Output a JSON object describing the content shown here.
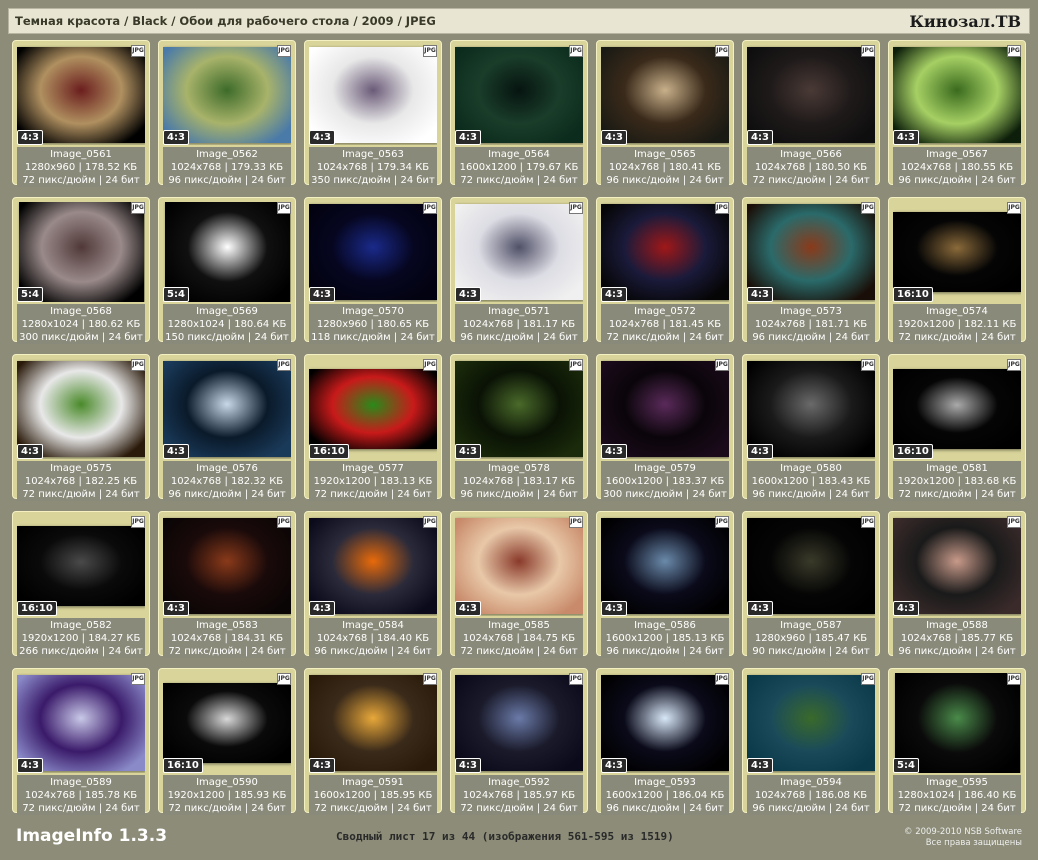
{
  "header": {
    "breadcrumb": "Темная красота / Black / Обои для рабочего стола / 2009 / JPEG",
    "brand": "Кинозал.ТВ"
  },
  "badge_label": "JPG",
  "images": [
    {
      "name": "Image_0561",
      "res": "1280x960",
      "size": "178.52 КБ",
      "dpi": "72 пикс/дюйм",
      "bits": "24 бит",
      "ratio": "4:3",
      "aspect": 1.333,
      "colors": [
        "#000000",
        "#6b1e1e",
        "#b09060"
      ]
    },
    {
      "name": "Image_0562",
      "res": "1024x768",
      "size": "179.33 КБ",
      "dpi": "96 пикс/дюйм",
      "bits": "24 бит",
      "ratio": "4:3",
      "aspect": 1.333,
      "colors": [
        "#4a7aa8",
        "#3d6b2a",
        "#a8b36a"
      ]
    },
    {
      "name": "Image_0563",
      "res": "1024x768",
      "size": "179.34 КБ",
      "dpi": "350 пикс/дюйм",
      "bits": "24 бит",
      "ratio": "4:3",
      "aspect": 1.333,
      "colors": [
        "#ffffff",
        "#6a5a78",
        "#e8e8e8"
      ]
    },
    {
      "name": "Image_0564",
      "res": "1600x1200",
      "size": "179.67 КБ",
      "dpi": "72 пикс/дюйм",
      "bits": "24 бит",
      "ratio": "4:3",
      "aspect": 1.333,
      "colors": [
        "#0b2b1c",
        "#061410",
        "#1a3d2a"
      ]
    },
    {
      "name": "Image_0565",
      "res": "1024x768",
      "size": "180.41 КБ",
      "dpi": "96 пикс/дюйм",
      "bits": "24 бит",
      "ratio": "4:3",
      "aspect": 1.333,
      "colors": [
        "#1a1a14",
        "#c8b08a",
        "#3a2a1a"
      ]
    },
    {
      "name": "Image_0566",
      "res": "1024x768",
      "size": "180.50 КБ",
      "dpi": "72 пикс/дюйм",
      "bits": "24 бит",
      "ratio": "4:3",
      "aspect": 1.333,
      "colors": [
        "#0e0e0e",
        "#4a3a36",
        "#1f1a1a"
      ]
    },
    {
      "name": "Image_0567",
      "res": "1024x768",
      "size": "180.55 КБ",
      "dpi": "96 пикс/дюйм",
      "bits": "24 бит",
      "ratio": "4:3",
      "aspect": 1.333,
      "colors": [
        "#0d1f0a",
        "#3a6a1e",
        "#a6d064"
      ]
    },
    {
      "name": "Image_0568",
      "res": "1280x1024",
      "size": "180.62 КБ",
      "dpi": "300 пикс/дюйм",
      "bits": "24 бит",
      "ratio": "5:4",
      "aspect": 1.25,
      "colors": [
        "#000000",
        "#503838",
        "#9a8a8a"
      ]
    },
    {
      "name": "Image_0569",
      "res": "1280x1024",
      "size": "180.64 КБ",
      "dpi": "150 пикс/дюйм",
      "bits": "24 бит",
      "ratio": "5:4",
      "aspect": 1.25,
      "colors": [
        "#000000",
        "#ffffff",
        "#101010"
      ]
    },
    {
      "name": "Image_0570",
      "res": "1280x960",
      "size": "180.65 КБ",
      "dpi": "118 пикс/дюйм",
      "bits": "24 бит",
      "ratio": "4:3",
      "aspect": 1.333,
      "colors": [
        "#020210",
        "#1a2a8a",
        "#060620"
      ]
    },
    {
      "name": "Image_0571",
      "res": "1024x768",
      "size": "181.17 КБ",
      "dpi": "96 пикс/дюйм",
      "bits": "24 бит",
      "ratio": "4:3",
      "aspect": 1.333,
      "colors": [
        "#f0f0f0",
        "#505068",
        "#dcdce4"
      ]
    },
    {
      "name": "Image_0572",
      "res": "1024x768",
      "size": "181.45 КБ",
      "dpi": "72 пикс/дюйм",
      "bits": "24 бит",
      "ratio": "4:3",
      "aspect": 1.333,
      "colors": [
        "#050505",
        "#a01818",
        "#1a1a3a"
      ]
    },
    {
      "name": "Image_0573",
      "res": "1024x768",
      "size": "181.71 КБ",
      "dpi": "96 пикс/дюйм",
      "bits": "24 бит",
      "ratio": "4:3",
      "aspect": 1.333,
      "colors": [
        "#1a0f08",
        "#8a3a1a",
        "#2a6a6a"
      ]
    },
    {
      "name": "Image_0574",
      "res": "1920x1200",
      "size": "182.11 КБ",
      "dpi": "72 пикс/дюйм",
      "bits": "24 бит",
      "ratio": "16:10",
      "aspect": 1.6,
      "colors": [
        "#000000",
        "#8a6a3a",
        "#050505"
      ]
    },
    {
      "name": "Image_0575",
      "res": "1024x768",
      "size": "182.25 КБ",
      "dpi": "72 пикс/дюйм",
      "bits": "24 бит",
      "ratio": "4:3",
      "aspect": 1.333,
      "colors": [
        "#2a1a0a",
        "#4a8a2a",
        "#e8e8e8"
      ]
    },
    {
      "name": "Image_0576",
      "res": "1024x768",
      "size": "182.32 КБ",
      "dpi": "96 пикс/дюйм",
      "bits": "24 бит",
      "ratio": "4:3",
      "aspect": 1.333,
      "colors": [
        "#1a3a5a",
        "#c8d8e8",
        "#0a1a2a"
      ]
    },
    {
      "name": "Image_0577",
      "res": "1920x1200",
      "size": "183.13 КБ",
      "dpi": "72 пикс/дюйм",
      "bits": "24 бит",
      "ratio": "16:10",
      "aspect": 1.6,
      "colors": [
        "#000000",
        "#2a8a1a",
        "#c81a1a"
      ]
    },
    {
      "name": "Image_0578",
      "res": "1024x768",
      "size": "183.17 КБ",
      "dpi": "96 пикс/дюйм",
      "bits": "24 бит",
      "ratio": "4:3",
      "aspect": 1.333,
      "colors": [
        "#1a2a0a",
        "#4a6a2a",
        "#0a1205"
      ]
    },
    {
      "name": "Image_0579",
      "res": "1600x1200",
      "size": "183.37 КБ",
      "dpi": "300 пикс/дюйм",
      "bits": "24 бит",
      "ratio": "4:3",
      "aspect": 1.333,
      "colors": [
        "#1a0a1a",
        "#5a2a5a",
        "#0a050a"
      ]
    },
    {
      "name": "Image_0580",
      "res": "1600x1200",
      "size": "183.43 КБ",
      "dpi": "96 пикс/дюйм",
      "bits": "24 бит",
      "ratio": "4:3",
      "aspect": 1.333,
      "colors": [
        "#000000",
        "#6a6a6a",
        "#1a1a1a"
      ]
    },
    {
      "name": "Image_0581",
      "res": "1920x1200",
      "size": "183.68 КБ",
      "dpi": "72 пикс/дюйм",
      "bits": "24 бит",
      "ratio": "16:10",
      "aspect": 1.6,
      "colors": [
        "#000000",
        "#aaaaaa",
        "#050505"
      ]
    },
    {
      "name": "Image_0582",
      "res": "1920x1200",
      "size": "184.27 КБ",
      "dpi": "266 пикс/дюйм",
      "bits": "24 бит",
      "ratio": "16:10",
      "aspect": 1.6,
      "colors": [
        "#000000",
        "#4a4a4a",
        "#0a0a0a"
      ]
    },
    {
      "name": "Image_0583",
      "res": "1024x768",
      "size": "184.31 КБ",
      "dpi": "72 пикс/дюйм",
      "bits": "24 бит",
      "ratio": "4:3",
      "aspect": 1.333,
      "colors": [
        "#0a0505",
        "#8a3a1a",
        "#1a0a0a"
      ]
    },
    {
      "name": "Image_0584",
      "res": "1024x768",
      "size": "184.40 КБ",
      "dpi": "96 пикс/дюйм",
      "bits": "24 бит",
      "ratio": "4:3",
      "aspect": 1.333,
      "colors": [
        "#0a0a1a",
        "#e86a0a",
        "#2a2a3a"
      ]
    },
    {
      "name": "Image_0585",
      "res": "1024x768",
      "size": "184.75 КБ",
      "dpi": "72 пикс/дюйм",
      "bits": "24 бит",
      "ratio": "4:3",
      "aspect": 1.333,
      "colors": [
        "#c88a6a",
        "#8a3a2a",
        "#e8c8a8"
      ]
    },
    {
      "name": "Image_0586",
      "res": "1600x1200",
      "size": "185.13 КБ",
      "dpi": "96 пикс/дюйм",
      "bits": "24 бит",
      "ratio": "4:3",
      "aspect": 1.333,
      "colors": [
        "#000000",
        "#6a8aaa",
        "#0a0a1a"
      ]
    },
    {
      "name": "Image_0587",
      "res": "1280x960",
      "size": "185.47 КБ",
      "dpi": "90 пикс/дюйм",
      "bits": "24 бит",
      "ratio": "4:3",
      "aspect": 1.333,
      "colors": [
        "#000000",
        "#3a3a2a",
        "#050505"
      ]
    },
    {
      "name": "Image_0588",
      "res": "1024x768",
      "size": "185.77 КБ",
      "dpi": "96 пикс/дюйм",
      "bits": "24 бит",
      "ratio": "4:3",
      "aspect": 1.333,
      "colors": [
        "#3a2a2a",
        "#c89a8a",
        "#1a1a1a"
      ]
    },
    {
      "name": "Image_0589",
      "res": "1024x768",
      "size": "185.78 КБ",
      "dpi": "72 пикс/дюйм",
      "bits": "24 бит",
      "ratio": "4:3",
      "aspect": 1.333,
      "colors": [
        "#8a8ac8",
        "#c8c8e8",
        "#3a1a6a"
      ]
    },
    {
      "name": "Image_0590",
      "res": "1920x1200",
      "size": "185.93 КБ",
      "dpi": "72 пикс/дюйм",
      "bits": "24 бит",
      "ratio": "16:10",
      "aspect": 1.6,
      "colors": [
        "#000000",
        "#d8d8d8",
        "#0a0a0a"
      ]
    },
    {
      "name": "Image_0591",
      "res": "1600x1200",
      "size": "185.95 КБ",
      "dpi": "72 пикс/дюйм",
      "bits": "24 бит",
      "ratio": "4:3",
      "aspect": 1.333,
      "colors": [
        "#2a1a0a",
        "#e8a83a",
        "#3a2a1a"
      ]
    },
    {
      "name": "Image_0592",
      "res": "1024x768",
      "size": "185.97 КБ",
      "dpi": "72 пикс/дюйм",
      "bits": "24 бит",
      "ratio": "4:3",
      "aspect": 1.333,
      "colors": [
        "#0a0a1a",
        "#6a7aa8",
        "#1a1a2a"
      ]
    },
    {
      "name": "Image_0593",
      "res": "1600x1200",
      "size": "186.04 КБ",
      "dpi": "96 пикс/дюйм",
      "bits": "24 бит",
      "ratio": "4:3",
      "aspect": 1.333,
      "colors": [
        "#000000",
        "#d8e8f8",
        "#0a0a1a"
      ]
    },
    {
      "name": "Image_0594",
      "res": "1024x768",
      "size": "186.08 КБ",
      "dpi": "96 пикс/дюйм",
      "bits": "24 бит",
      "ratio": "4:3",
      "aspect": 1.333,
      "colors": [
        "#0a3a4a",
        "#3a6a2a",
        "#1a4a5a"
      ]
    },
    {
      "name": "Image_0595",
      "res": "1280x1024",
      "size": "186.40 КБ",
      "dpi": "72 пикс/дюйм",
      "bits": "24 бит",
      "ratio": "5:4",
      "aspect": 1.25,
      "colors": [
        "#000000",
        "#4a8a4a",
        "#0a0a0a"
      ]
    }
  ],
  "footer": {
    "app_name": "ImageInfo 1.3.3",
    "summary": "Сводный лист 17 из 44 (изображения 561-595 из 1519)",
    "copyright": "© 2009-2010 NSB Software",
    "rights": "Все права защищены"
  }
}
